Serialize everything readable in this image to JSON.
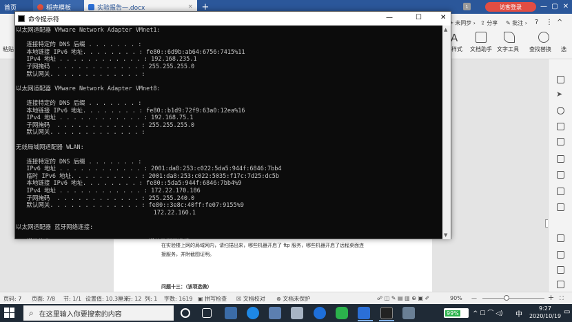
{
  "wps": {
    "tabs": [
      {
        "label": "首页"
      },
      {
        "label": "稻壳模板"
      },
      {
        "label": "实验报告一.docx"
      }
    ],
    "visitor_login": "访客登录",
    "badge": "1",
    "ribbon": {
      "unsynced": "未同步",
      "share": "分享",
      "comment": "批注",
      "paste": "粘贴",
      "style_label": "样式",
      "doc_assistant": "文档助手",
      "text_tools": "文字工具",
      "find_replace": "查找替换",
      "select": "选"
    },
    "doc": {
      "line1": "在实验楼上网的局域网内，请扫描出来，哪些机器开启了 ftp 服务，哪些机器开启了远程桌面连",
      "line2": "接服务，并附截图证明。",
      "question": "问题十三：（该项选做）"
    },
    "status": {
      "page": "页码: 7",
      "pages": "页面: 7/8",
      "section": "节: 1/1",
      "setting": "设置值: 10.3厘米",
      "row": "行: 12",
      "col": "列: 1",
      "words": "字数: 1619",
      "spellcheck": "拼写检查",
      "proof": "文档校对",
      "unprotected": "文档未保护",
      "zoom": "90%"
    }
  },
  "cmd": {
    "title": "命令提示符",
    "lines": [
      "以太网适配器 VMware Network Adapter VMnet1:",
      "",
      "   连接特定的 DNS 后缀 . . . . . . . :",
      "   本地链接 IPv6 地址. . . . . . . . : fe80::6d9b:ab64:6756:7415%11",
      "   IPv4 地址 . . . . . . . . . . . . : 192.168.235.1",
      "   子网掩码  . . . . . . . . . . . . : 255.255.255.0",
      "   默认网关. . . . . . . . . . . . . :",
      "",
      "以太网适配器 VMware Network Adapter VMnet8:",
      "",
      "   连接特定的 DNS 后缀 . . . . . . . :",
      "   本地链接 IPv6 地址. . . . . . . . : fe80::b1d9:72f9:63a0:12ea%16",
      "   IPv4 地址 . . . . . . . . . . . . : 192.168.75.1",
      "   子网掩码  . . . . . . . . . . . . : 255.255.255.0",
      "   默认网关. . . . . . . . . . . . . :",
      "",
      "无线局域网适配器 WLAN:",
      "",
      "   连接特定的 DNS 后缀 . . . . . . . :",
      "   IPv6 地址 . . . . . . . . . . . . : 2001:da8:253:c022:5da5:944f:6846:7bb4",
      "   临时 IPv6 地址. . . . . . . . . . : 2001:da8:253:c022:5035:f17c:7d25:dc5b",
      "   本地链接 IPv6 地址. . . . . . . . : fe80::5da5:944f:6846:7bb4%9",
      "   IPv4 地址 . . . . . . . . . . . . : 172.22.170.186",
      "   子网掩码  . . . . . . . . . . . . : 255.255.240.0",
      "   默认网关. . . . . . . . . . . . . : fe80::3e8c:40ff:fe07:9155%9",
      "                                       172.22.160.1",
      "",
      "以太网适配器 蓝牙网络连接:",
      "",
      "   媒体状态  . . . . . . . . . . . . : 媒体已断开连接"
    ]
  },
  "taskbar": {
    "search_placeholder": "在这里输入你要搜索的内容",
    "battery": "99%",
    "ime": "中",
    "time": "9:27",
    "date": "2020/10/19"
  },
  "colors": {
    "wps_blue": "#2b579a",
    "cmd_bg": "#0c0c0c",
    "cmd_text": "#c8c8c8",
    "visitor_red": "#e14d43",
    "taskbar": "#1f2a36"
  }
}
